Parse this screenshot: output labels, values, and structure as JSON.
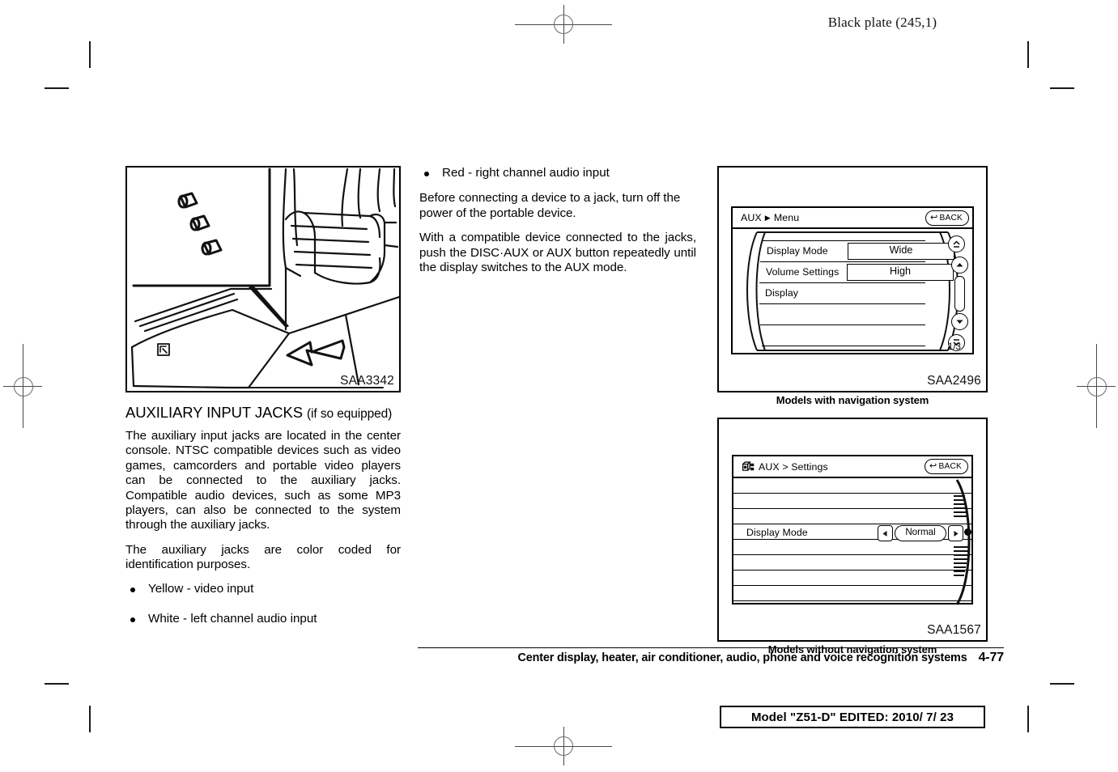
{
  "header": {
    "black_plate": "Black plate (245,1)"
  },
  "left_column": {
    "figure": {
      "code": "SAA3342",
      "alt_name": "center-console-auxiliary-jacks-illustration"
    },
    "section_title_main": "AUXILIARY INPUT JACKS",
    "section_title_suffix": "(if so equipped)",
    "paragraph_1": "The auxiliary input jacks are located in the center console. NTSC compatible devices such as video games, camcorders and portable video players can be connected to the auxiliary jacks. Compatible audio devices, such as some MP3 players, can also be connected to the system through the auxiliary jacks.",
    "paragraph_2": "The auxiliary jacks are color coded for identification purposes.",
    "bullets": [
      "Yellow - video input",
      "White - left channel audio input"
    ]
  },
  "middle_column": {
    "bullets": [
      "Red - right channel audio input"
    ],
    "paragraph_1": "Before connecting a device to a jack, turn off the power of the portable device.",
    "paragraph_2": "With a compatible device connected to the jacks, push the DISC·AUX or AUX button repeatedly until the display switches to the AUX mode."
  },
  "right_column": {
    "nav_screen": {
      "title": "AUX",
      "title_arrow": "▶",
      "title_sub": "Menu",
      "back_label": "BACK",
      "back_icon": "↩",
      "rows": [
        {
          "label": "Display Mode",
          "value": "Wide"
        },
        {
          "label": "Volume Settings",
          "value": "High"
        },
        {
          "label": "Display",
          "value": ""
        }
      ],
      "page_indicator": "1/3",
      "scroll_buttons": [
        "▲̄",
        "▲",
        "▼",
        "▼̱"
      ],
      "figure_code": "SAA2496",
      "caption": "Models with navigation system"
    },
    "no_nav_screen": {
      "title": "AUX > Settings",
      "back_label": "BACK",
      "back_icon": "↩",
      "row_label": "Display Mode",
      "row_value": "Normal",
      "left_arrow": "◀",
      "right_arrow": "▶",
      "figure_code": "SAA1567",
      "caption": "Models without navigation system"
    }
  },
  "footer": {
    "chapter_title": "Center display, heater, air conditioner, audio, phone and voice recognition systems",
    "page_number": "4-77",
    "model_stamp": "Model \"Z51-D\"  EDITED:  2010/ 7/ 23"
  }
}
